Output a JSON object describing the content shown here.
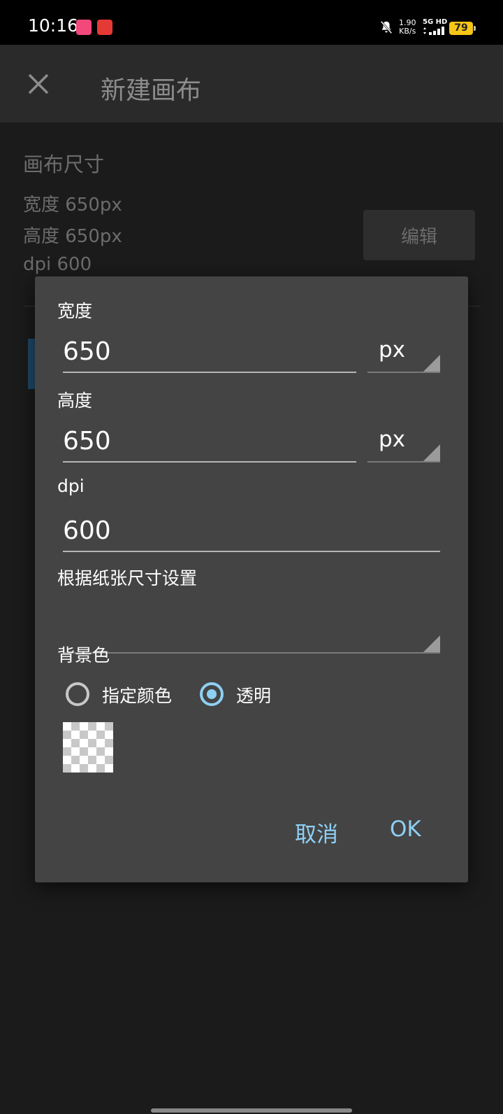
{
  "status_bar": {
    "time": "10:16",
    "speed_value": "1.90",
    "speed_unit": "KB/s",
    "network": "5G HD",
    "battery": "79",
    "battery_color": "#f5c518"
  },
  "app_bar": {
    "title": "新建画布",
    "close_icon": "close-icon"
  },
  "background": {
    "section_title": "画布尺寸",
    "width_line": "宽度 650px",
    "height_line": "高度 650px",
    "dpi_line": "dpi 600",
    "edit_label": "编辑"
  },
  "dialog": {
    "width": {
      "label": "宽度",
      "value": "650",
      "unit": "px"
    },
    "height": {
      "label": "高度",
      "value": "650",
      "unit": "px"
    },
    "dpi": {
      "label": "dpi",
      "value": "600"
    },
    "paper_size": {
      "label": "根据纸张尺寸设置",
      "value": ""
    },
    "background": {
      "label": "背景色",
      "options": [
        {
          "label": "指定颜色",
          "selected": false
        },
        {
          "label": "透明",
          "selected": true
        }
      ]
    },
    "cancel_label": "取消",
    "ok_label": "OK",
    "accent_color": "#8ed0f5"
  }
}
